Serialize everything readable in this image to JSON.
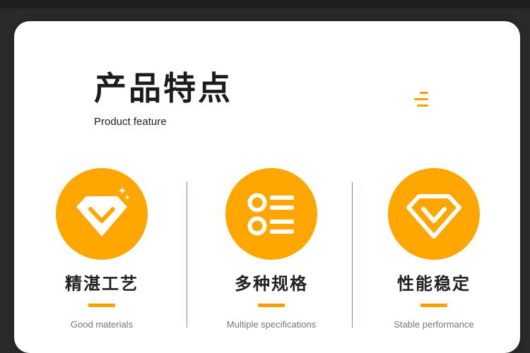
{
  "header": {
    "title": "产品特点",
    "subtitle": "Product feature",
    "menu_icon": "menu-lines-icon"
  },
  "features": [
    {
      "title": "精湛工艺",
      "subtitle": "Good materials",
      "icon": "sparkling-diamond-icon"
    },
    {
      "title": "多种规格",
      "subtitle": "Multiple specifications",
      "icon": "list-icon"
    },
    {
      "title": "性能稳定",
      "subtitle": "Stable performance",
      "icon": "diamond-outline-icon"
    }
  ],
  "colors": {
    "accent": "#ffa700",
    "accent_dark": "#f5a100",
    "divider": "#6b8fd8",
    "text": "#222222",
    "subtext": "#777777"
  }
}
